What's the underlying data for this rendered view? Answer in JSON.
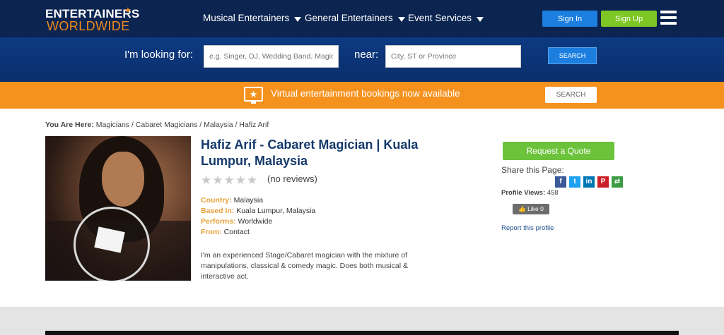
{
  "logo": {
    "line1": "ENTERTAINERS",
    "line2": "WORLDWIDE",
    "star": "★"
  },
  "nav": {
    "items": [
      {
        "label": "Musical Entertainers"
      },
      {
        "label": "General Entertainers"
      },
      {
        "label": "Event Services"
      }
    ],
    "signin_label": "Sign In",
    "signup_label": "Sign Up",
    "menu_icon": "hamburger-icon"
  },
  "search": {
    "looking_label": "I'm looking for:",
    "what_placeholder": "e.g. Singer, DJ, Wedding Band, Magician",
    "near_label": "near:",
    "where_placeholder": "City, ST or Province",
    "button_label": "SEARCH"
  },
  "banner": {
    "icon": "tv-star-icon",
    "text": "Virtual entertainment bookings now available",
    "button_label": "SEARCH",
    "color": "#f5921e"
  },
  "breadcrumb": {
    "prefix": "You Are Here:",
    "path": "Magicians / Cabaret Magicians / Malaysia / Hafiz Arif"
  },
  "profile": {
    "title": "Hafiz Arif - Cabaret Magician | Kuala Lumpur, Malaysia",
    "rating": 0,
    "reviews_text": "(no reviews)",
    "facts": [
      {
        "key": "Country:",
        "value": "Malaysia"
      },
      {
        "key": "Based In:",
        "value": "Kuala Lumpur, Malaysia"
      },
      {
        "key": "Performs:",
        "value": "Worldwide"
      },
      {
        "key": "From:",
        "value": "Contact"
      }
    ],
    "bio": "I'm an experienced Stage/Cabaret magician with the mixture of manipulations, classical & comedy magic. Does both musical & interactive act."
  },
  "sidebar": {
    "quote_label": "Request a Quote",
    "share_label": "Share this Page:",
    "share_icons": [
      {
        "name": "facebook-icon",
        "glyph": "f",
        "color": "#3b5998"
      },
      {
        "name": "twitter-icon",
        "glyph": "t",
        "color": "#1da1f2"
      },
      {
        "name": "linkedin-icon",
        "glyph": "in",
        "color": "#0077b5"
      },
      {
        "name": "pinterest-icon",
        "glyph": "P",
        "color": "#cb2027"
      },
      {
        "name": "more-share-icon",
        "glyph": "⇄",
        "color": "#3c9b43"
      }
    ],
    "views_label": "Profile Views:",
    "views_value": "458",
    "like_label": "👍 Like 0",
    "report_label": "Report this profile"
  }
}
